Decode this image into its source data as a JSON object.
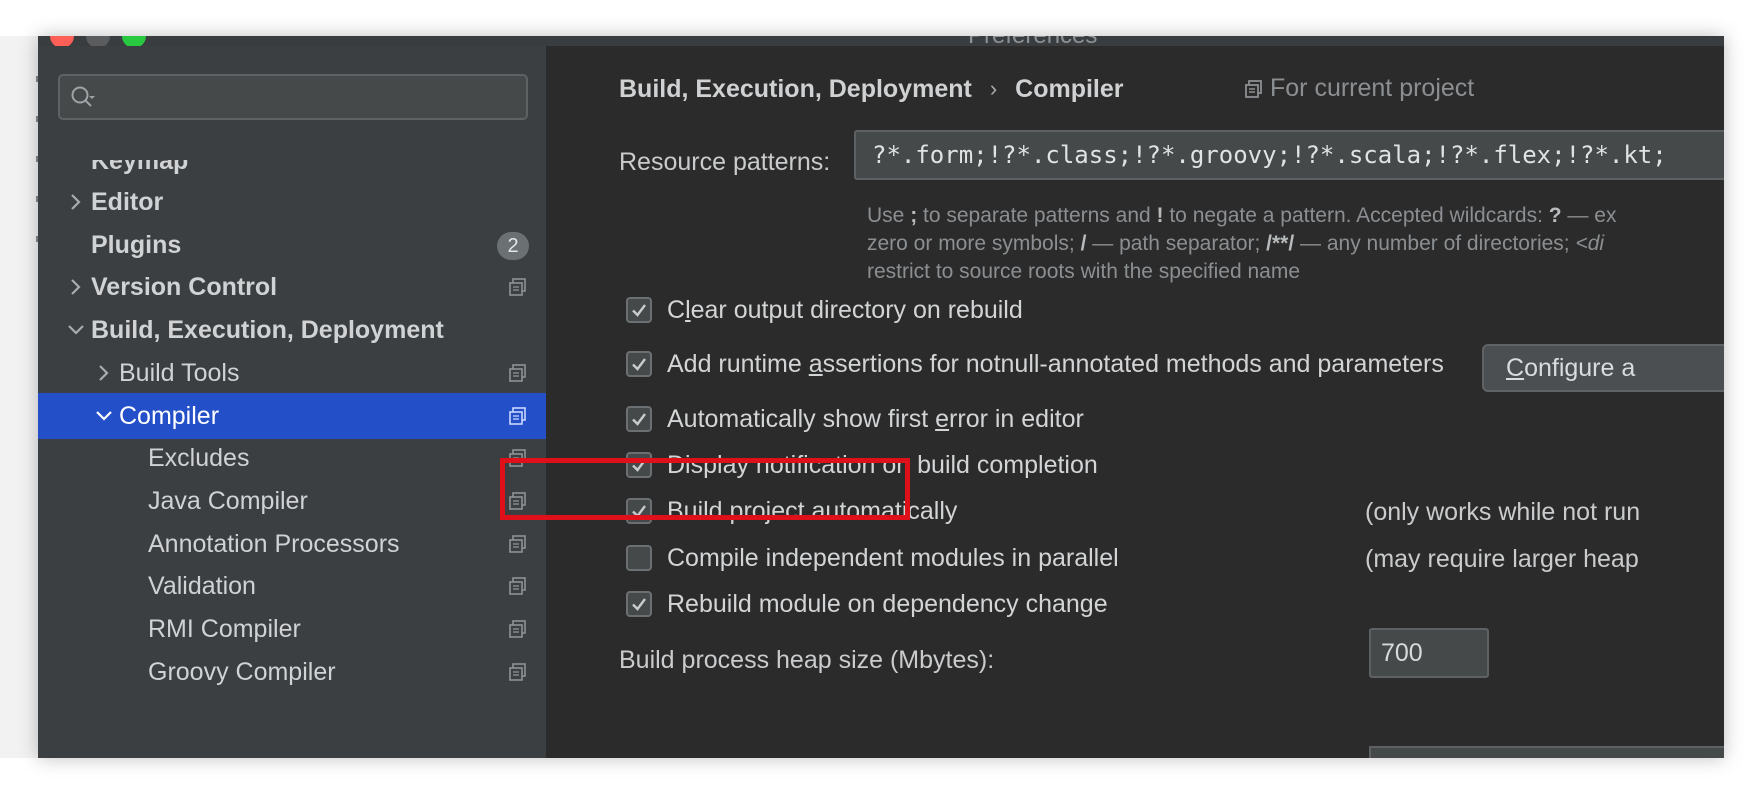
{
  "window": {
    "title": "Preferences",
    "controls": {
      "close_color": "#fe5f57",
      "minimize_color": "#5a5c5e",
      "maximize_color": "#28c940"
    }
  },
  "sidebar": {
    "search": {
      "value": "",
      "placeholder": ""
    },
    "items": [
      {
        "label": "Keymap",
        "bold": true,
        "partial": true
      },
      {
        "label": "Editor",
        "bold": true,
        "chevron": "chevron-right-icon"
      },
      {
        "label": "Plugins",
        "bold": true,
        "badge": "2"
      },
      {
        "label": "Version Control",
        "bold": true,
        "chevron": "chevron-right-icon",
        "project_icon": true
      },
      {
        "label": "Build, Execution, Deployment",
        "bold": true,
        "chevron": "chevron-down-icon"
      },
      {
        "label": "Build Tools",
        "chevron": "chevron-right-icon",
        "project_icon": true
      },
      {
        "label": "Compiler",
        "chevron": "chevron-down-icon",
        "project_icon": true,
        "selected": true
      },
      {
        "label": "Excludes",
        "project_icon": true
      },
      {
        "label": "Java Compiler",
        "project_icon": true
      },
      {
        "label": "Annotation Processors",
        "project_icon": true
      },
      {
        "label": "Validation",
        "project_icon": true
      },
      {
        "label": "RMI Compiler",
        "project_icon": true
      },
      {
        "label": "Groovy Compiler",
        "project_icon": true
      }
    ],
    "selected_color": "#2350c8"
  },
  "main": {
    "breadcrumb": {
      "parent": "Build, Execution, Deployment",
      "separator": "›",
      "current": "Compiler"
    },
    "for_current_project": "For current project",
    "resource_patterns": {
      "label": "Resource patterns:",
      "value": "?*.form;!?*.class;!?*.groovy;!?*.scala;!?*.flex;!?*.kt;",
      "hint_line1_a": "Use ",
      "hint_line1_b": ";",
      "hint_line1_c": " to separate patterns and ",
      "hint_line1_d": "!",
      "hint_line1_e": " to negate a pattern. Accepted wildcards: ",
      "hint_line1_f": "?",
      "hint_line1_g": " — ex",
      "hint_line2_a": "zero or more symbols; ",
      "hint_line2_b": "/",
      "hint_line2_c": " — path separator; ",
      "hint_line2_d": "/**/",
      "hint_line2_e": " — any number of directories; ",
      "hint_line2_f": "<di",
      "hint_line3": "restrict to source roots with the specified name"
    },
    "options": {
      "clear_output": {
        "label_pre": "C",
        "label_u": "l",
        "label_post": "ear output directory on rebuild",
        "checked": true
      },
      "runtime_assertions": {
        "label_pre": "Add runtime ",
        "label_u": "a",
        "label_post": "ssertions for notnull-annotated methods and parameters",
        "checked": true
      },
      "show_first_error": {
        "label_pre": "Automatically show first ",
        "label_u": "e",
        "label_post": "rror in editor",
        "checked": true
      },
      "display_notification": {
        "label": "Display notification on build completion",
        "checked": true
      },
      "build_automatically": {
        "label": "Build project automatically",
        "checked": true,
        "note": "(only works while not run"
      },
      "compile_parallel": {
        "label": "Compile independent modules in parallel",
        "checked": false,
        "note": "(may require larger heap"
      },
      "rebuild_module": {
        "label": "Rebuild module on dependency change",
        "checked": true
      }
    },
    "configure_button": {
      "label_u": "C",
      "label_rest": "onfigure a"
    },
    "heap_size": {
      "label": "Build process heap size (Mbytes):",
      "value": "700"
    },
    "highlight_color": "#e0101a"
  }
}
